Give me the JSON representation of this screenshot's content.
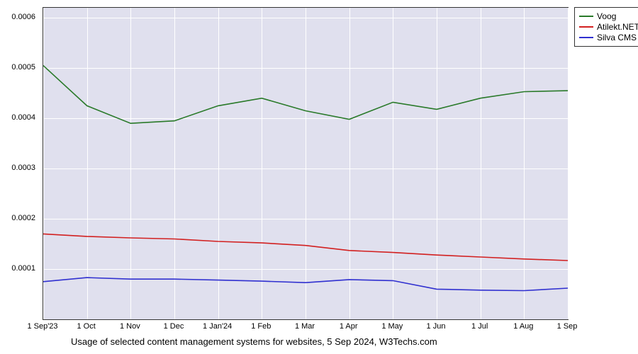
{
  "chart_data": {
    "type": "line",
    "x": [
      "1 Sep'23",
      "1 Oct",
      "1 Nov",
      "1 Dec",
      "1 Jan'24",
      "1 Feb",
      "1 Mar",
      "1 Apr",
      "1 May",
      "1 Jun",
      "1 Jul",
      "1 Aug",
      "1 Sep"
    ],
    "y_ticks": [
      0.0001,
      0.0002,
      0.0003,
      0.0004,
      0.0005,
      0.0006
    ],
    "ylim": [
      0.0,
      0.00062
    ],
    "series": [
      {
        "name": "Voog",
        "color": "#2a7a2a",
        "values": [
          0.000505,
          0.000425,
          0.00039,
          0.000395,
          0.000425,
          0.00044,
          0.000415,
          0.000398,
          0.000432,
          0.000418,
          0.00044,
          0.000453,
          0.000455
        ]
      },
      {
        "name": "Atilekt.NET",
        "color": "#d22020",
        "values": [
          0.00017,
          0.000165,
          0.000162,
          0.00016,
          0.000155,
          0.000152,
          0.000147,
          0.000137,
          0.000133,
          0.000128,
          0.000124,
          0.00012,
          0.000117
        ]
      },
      {
        "name": "Silva CMS",
        "color": "#3030d0",
        "values": [
          7.5e-05,
          8.3e-05,
          8e-05,
          8e-05,
          7.8e-05,
          7.6e-05,
          7.3e-05,
          7.9e-05,
          7.7e-05,
          6e-05,
          5.8e-05,
          5.7e-05,
          6.2e-05
        ]
      }
    ],
    "caption": "Usage of selected content management systems for websites, 5 Sep 2024, W3Techs.com"
  }
}
